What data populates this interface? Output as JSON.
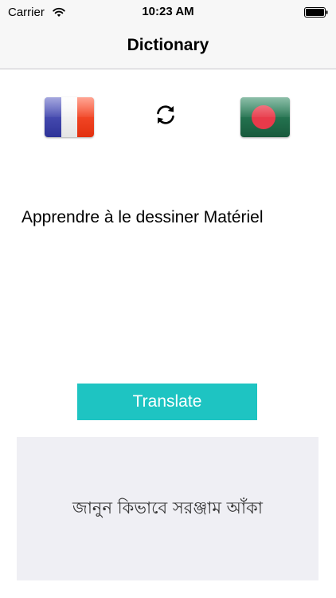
{
  "status_bar": {
    "carrier": "Carrier",
    "time": "10:23 AM",
    "wifi_icon": "wifi-icon",
    "battery_icon": "battery-icon"
  },
  "nav": {
    "title": "Dictionary"
  },
  "languages": {
    "source_flag": "france-flag-icon",
    "target_flag": "bangladesh-flag-icon",
    "swap_icon": "swap-icon"
  },
  "input": {
    "text": "Apprendre à le dessiner Matériel"
  },
  "actions": {
    "translate_label": "Translate"
  },
  "output": {
    "text": "জানুন কিভাবে সরঞ্জাম আঁকা"
  },
  "colors": {
    "accent": "#1ec4c2",
    "result_background": "#efeff4",
    "bar_background": "#f7f7f7",
    "fr_blue": "#3a3fa6",
    "fr_white": "#f4f4f4",
    "fr_red": "#f03a1e",
    "bd_green": "#1e6a4a",
    "bd_red": "#e83a4a"
  }
}
